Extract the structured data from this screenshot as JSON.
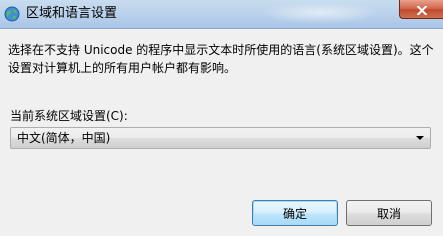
{
  "window": {
    "title": "区域和语言设置",
    "close_symbol": "✕"
  },
  "dialog": {
    "description": "选择在不支持 Unicode 的程序中显示文本时所使用的语言(系统区域设置)。这个设置对计算机上的所有用户帐户都有影响。",
    "locale_label": "当前系统区域设置(C):",
    "locale_value": "中文(简体，中国)",
    "ok_label": "确定",
    "cancel_label": "取消"
  },
  "icons": {
    "app": "globe-icon",
    "close": "close-icon",
    "dropdown": "chevron-down-icon"
  },
  "colors": {
    "titlebar": "#bcd3ec",
    "close_button": "#c04a2e",
    "default_button_border": "#3c7fb1",
    "dialog_background": "#f0f0f0"
  }
}
